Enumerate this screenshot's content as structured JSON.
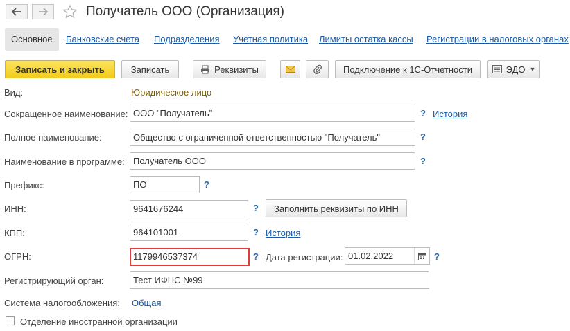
{
  "header": {
    "title": "Получатель ООО (Организация)",
    "back_icon": "arrow-left-icon",
    "forward_icon": "arrow-right-icon",
    "favorite_icon": "star-icon"
  },
  "tabs": [
    {
      "label": "Основное",
      "active": true
    },
    {
      "label": "Банковские счета"
    },
    {
      "label": "Подразделения"
    },
    {
      "label": "Учетная политика"
    },
    {
      "label": "Лимиты остатка кассы"
    },
    {
      "label": "Регистрации в налоговых органах"
    }
  ],
  "toolbar": {
    "save_close": "Записать и закрыть",
    "save": "Записать",
    "requisites": "Реквизиты",
    "connect": "Подключение к 1С-Отчетности",
    "edo": "ЭДО"
  },
  "form": {
    "kind_label": "Вид:",
    "kind_value": "Юридическое лицо",
    "short_name_label": "Сокращенное наименование:",
    "short_name_value": "ООО \"Получатель\"",
    "full_name_label": "Полное наименование:",
    "full_name_value": "Общество с ограниченной ответственностью \"Получатель\"",
    "program_name_label": "Наименование в программе:",
    "program_name_value": "Получатель ООО",
    "prefix_label": "Префикс:",
    "prefix_value": "ПО",
    "inn_label": "ИНН:",
    "inn_value": "9641676244",
    "fill_by_inn": "Заполнить реквизиты по ИНН",
    "kpp_label": "КПП:",
    "kpp_value": "964101001",
    "ogrn_label": "ОГРН:",
    "ogrn_value": "1179946537374",
    "reg_date_label": "Дата регистрации:",
    "reg_date_value": "01.02.2022",
    "reg_authority_label": "Регистрирующий орган:",
    "reg_authority_value": "Тест ИФНС №99",
    "tax_system_label": "Система налогообложения:",
    "tax_system_value": "Общая",
    "foreign_branch_label": "Отделение иностранной организации",
    "help_mark": "?",
    "history_link": "История"
  },
  "colors": {
    "primary_button": "#f5d02a",
    "link": "#1a5aa8",
    "highlight": "#e53a3a"
  }
}
